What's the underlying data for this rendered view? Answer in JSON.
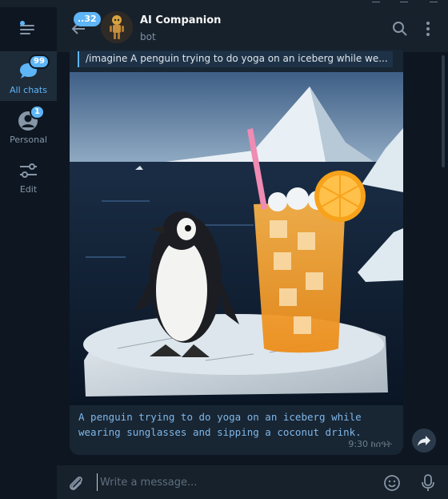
{
  "rail": {
    "folders": [
      {
        "label": "All chats",
        "badge": "99",
        "icon": "chats-icon",
        "active": true
      },
      {
        "label": "Personal",
        "badge": "1",
        "icon": "person-icon",
        "active": false
      },
      {
        "label": "Edit",
        "badge": "",
        "icon": "sliders-icon",
        "active": false
      }
    ]
  },
  "header": {
    "back_badge": "..32",
    "title": "AI Companion",
    "subtitle": "bot"
  },
  "message": {
    "reply_text": "/imagine A penguin trying to do yoga on an iceberg while we...",
    "caption": "A penguin trying to do yoga on an iceberg while wearing sunglasses and sipping a coconut drink.",
    "time": "9:30 ከሰዓት"
  },
  "composer": {
    "placeholder": "Write a message..."
  },
  "colors": {
    "accent": "#5eb5f7",
    "background": "#0e1621",
    "panel": "#17212b",
    "bubble": "#182533"
  }
}
